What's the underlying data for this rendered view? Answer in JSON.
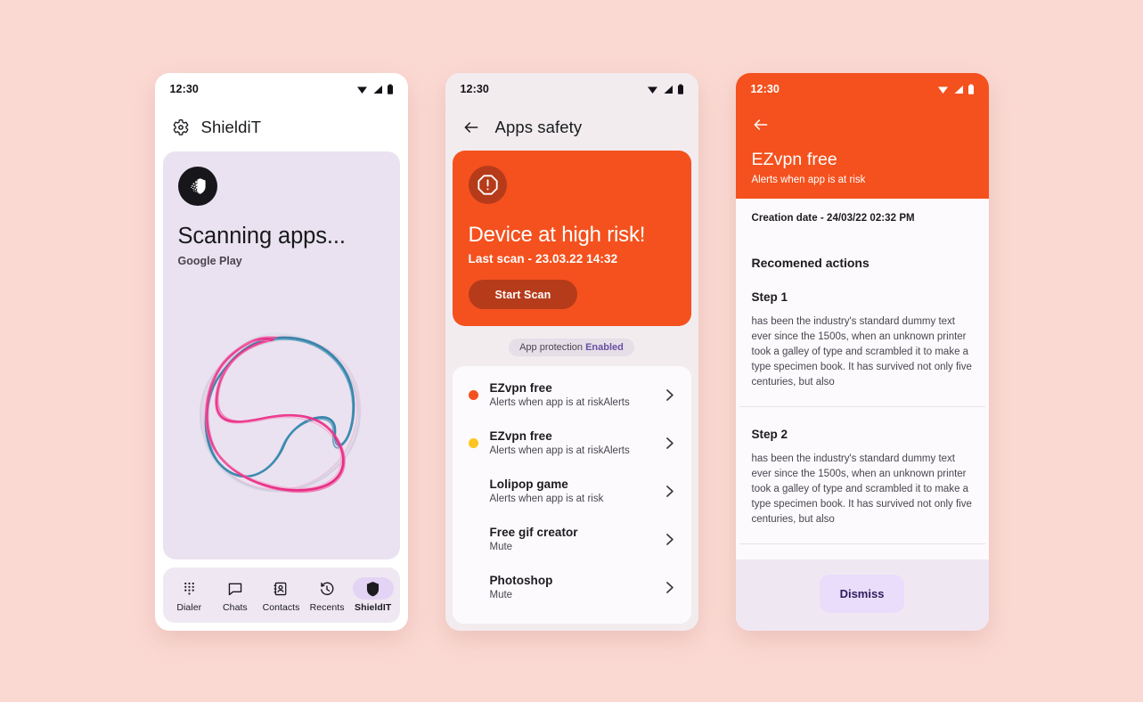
{
  "page": {
    "background_color": "#FBD9D3"
  },
  "theme": {
    "orange": "#F4511E",
    "orange_dark": "#B63B1B",
    "lavender_card": "#EAE2F0",
    "purple_accent": "#6750A4",
    "dismiss_bg": "#E9DDFB"
  },
  "phone1": {
    "status": {
      "time": "12:30"
    },
    "appbar": {
      "icon": "gear-icon",
      "title": "ShieldiT"
    },
    "card": {
      "badge_icon": "shield-dissolve-icon",
      "title": "Scanning apps...",
      "subtitle": "Google Play",
      "visual": "scanning-waveform-rings"
    },
    "bottom_nav": {
      "items": [
        {
          "label": "Dialer",
          "icon": "dialpad-icon",
          "active": false
        },
        {
          "label": "Chats",
          "icon": "chat-icon",
          "active": false
        },
        {
          "label": "Contacts",
          "icon": "contacts-icon",
          "active": false
        },
        {
          "label": "Recents",
          "icon": "history-icon",
          "active": false
        },
        {
          "label": "ShieldIT",
          "icon": "shield-icon",
          "active": true
        }
      ]
    }
  },
  "phone2": {
    "status": {
      "time": "12:30"
    },
    "appbar": {
      "back_icon": "arrow-left-icon",
      "title": "Apps safety"
    },
    "risk_card": {
      "badge_icon": "alert-octagon-icon",
      "title": "Device at high risk!",
      "last_scan": "Last scan - 23.03.22 14:32",
      "button_label": "Start Scan"
    },
    "protection": {
      "label": "App protection",
      "status": "Enabled"
    },
    "apps": [
      {
        "name": "EZvpn free",
        "desc": "Alerts when app is at riskAlerts",
        "dot": "#F4511E"
      },
      {
        "name": "EZvpn free",
        "desc": "Alerts when app is at riskAlerts",
        "dot": "#FCC521"
      },
      {
        "name": "Lolipop game",
        "desc": "Alerts when app is at risk",
        "dot": null
      },
      {
        "name": "Free gif creator",
        "desc": "Mute",
        "dot": null
      },
      {
        "name": "Photoshop",
        "desc": "Mute",
        "dot": null
      }
    ]
  },
  "phone3": {
    "status": {
      "time": "12:30"
    },
    "header": {
      "back_icon": "arrow-left-icon",
      "title": "EZvpn free",
      "subtitle": "Alerts when app is at risk"
    },
    "creation_date": "Creation date - 24/03/22 02:32 PM",
    "recommended_title": "Recomened actions",
    "steps": [
      {
        "title": "Step 1",
        "body": "has been the industry's standard dummy text ever since the 1500s, when an unknown printer took a galley of type and scrambled it to make a type specimen book. It has survived not only five centuries, but also"
      },
      {
        "title": "Step 2",
        "body": "has been the industry's standard dummy text ever since the 1500s, when an unknown printer took a galley of type and scrambled it to make a type specimen book. It has survived not only five centuries, but also"
      }
    ],
    "dismiss_label": "Dismiss"
  }
}
